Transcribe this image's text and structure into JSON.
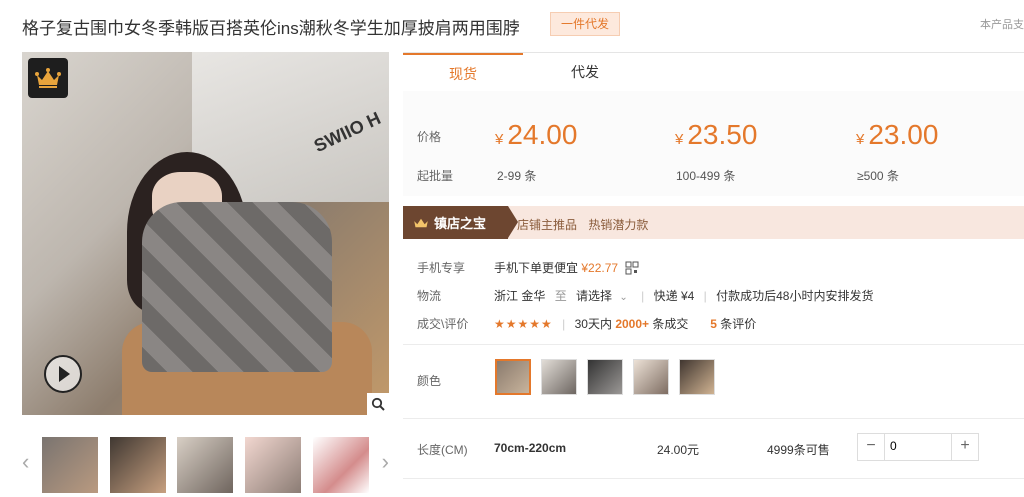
{
  "product": {
    "title": "格子复古围巾女冬季韩版百搭英伦ins潮秋冬学生加厚披肩两用围脖",
    "badge": "一件代发",
    "note": "本产品支"
  },
  "tabs": [
    {
      "label": "现货",
      "active": true
    },
    {
      "label": "代发",
      "active": false
    }
  ],
  "pricing": {
    "price_label": "价格",
    "moq_label": "起批量",
    "currency": "¥",
    "tiers": [
      {
        "price": "24.00",
        "range": "2-99 条"
      },
      {
        "price": "23.50",
        "range": "100-499 条"
      },
      {
        "price": "23.00",
        "range": "≥500 条"
      }
    ]
  },
  "shop": {
    "tag": "镇店之宝",
    "tags": [
      "店铺主推品",
      "热销潜力款"
    ]
  },
  "info": {
    "mobile_label": "手机专享",
    "mobile_text": "手机下单更便宜",
    "mobile_price": "¥22.77",
    "logistics_label": "物流",
    "origin": "浙江 金华",
    "to": "至",
    "dest": "请选择",
    "express": "快递 ¥4",
    "ship_note": "付款成功后48小时内安排发货",
    "trade_label": "成交\\评价",
    "stars": "★★★★★",
    "days_text": "30天内",
    "deals": "2000+",
    "deals_unit": "条成交",
    "reviews": "5",
    "reviews_unit": "条评价"
  },
  "color": {
    "label": "颜色"
  },
  "size": {
    "label": "长度(CM)",
    "value": "70cm-220cm",
    "price": "24.00元",
    "stock": "4999条可售",
    "quantity": "0"
  },
  "colors": {
    "accent": "#e4782b",
    "shop_tag_bg": "#6d4630",
    "shop_bar_bg": "#f8e7df"
  },
  "icons": [
    "crown-icon",
    "play-icon",
    "zoom-icon",
    "chevron-left-icon",
    "chevron-right-icon",
    "qr-code-icon"
  ]
}
